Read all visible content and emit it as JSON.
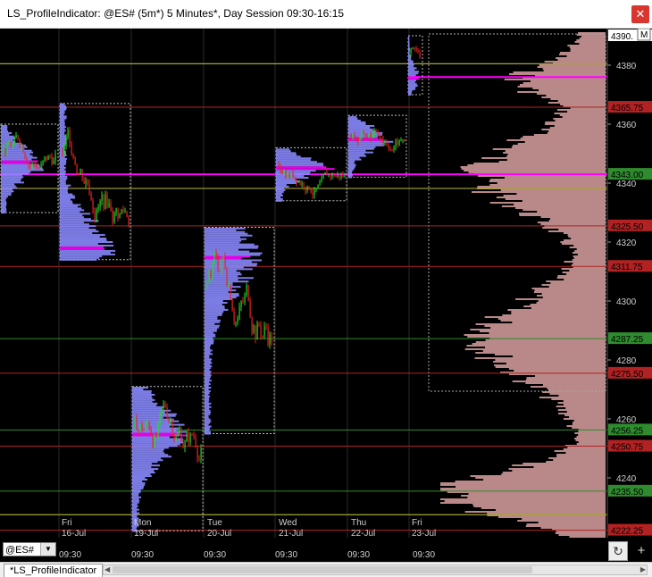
{
  "window": {
    "title": "LS_ProfileIndicator: @ES# (5m*) 5 Minutes*, Day Session 09:30-16:15",
    "close_glyph": "✕"
  },
  "chart": {
    "price_labels": [
      {
        "text": "4390.",
        "price": 4390.0,
        "bg": "#ffffff",
        "fg": "#000000"
      },
      {
        "text": "4365.75",
        "price": 4365.75,
        "bg": "#b22222",
        "fg": "#000000"
      },
      {
        "text": "4343.00",
        "price": 4343.0,
        "bg": "#2e8b2e",
        "fg": "#000000"
      },
      {
        "text": "4325.50",
        "price": 4325.5,
        "bg": "#b22222",
        "fg": "#000000"
      },
      {
        "text": "4311.75",
        "price": 4311.75,
        "bg": "#b22222",
        "fg": "#000000"
      },
      {
        "text": "4287.25",
        "price": 4287.25,
        "bg": "#2e8b2e",
        "fg": "#000000"
      },
      {
        "text": "4275.50",
        "price": 4275.5,
        "bg": "#b22222",
        "fg": "#000000"
      },
      {
        "text": "4256.25",
        "price": 4256.25,
        "bg": "#2e8b2e",
        "fg": "#000000"
      },
      {
        "text": "4250.75",
        "price": 4250.75,
        "bg": "#b22222",
        "fg": "#000000"
      },
      {
        "text": "4235.50",
        "price": 4235.5,
        "bg": "#2e8b2e",
        "fg": "#000000"
      },
      {
        "text": "4222.25",
        "price": 4222.25,
        "bg": "#b22222",
        "fg": "#000000"
      }
    ],
    "axis_ticks": [
      "4380",
      "4360",
      "4340",
      "4320",
      "4300",
      "4280",
      "4260",
      "4240"
    ],
    "axis_tick_values": [
      4380,
      4360,
      4340,
      4320,
      4300,
      4280,
      4260,
      4240
    ],
    "marker_letter": "M",
    "days": [
      {
        "weekday": "Fri",
        "date": "16-Jul"
      },
      {
        "weekday": "Mon",
        "date": "19-Jul"
      },
      {
        "weekday": "Tue",
        "date": "20-Jul"
      },
      {
        "weekday": "Wed",
        "date": "21-Jul"
      },
      {
        "weekday": "Thu",
        "date": "22-Jul"
      },
      {
        "weekday": "Fri",
        "date": "23-Jul"
      }
    ],
    "colors": {
      "background": "#000000",
      "profile": "#8a8aff",
      "composite_profile": "#d9a0a0",
      "poc": "#ff00ff",
      "value_area_line": "#a6a630",
      "support_line": "#2e8b2e",
      "resistance_line": "#b22222",
      "up_candle": "#22dd22",
      "down_candle": "#ee2222"
    }
  },
  "footer": {
    "symbol": "@ES#",
    "times": [
      "09:30",
      "09:30",
      "09:30",
      "09:30",
      "09:30",
      "09:30"
    ],
    "refresh_glyph": "↻",
    "add_glyph": "+"
  },
  "tabs": [
    {
      "label": "*LS_ProfileIndicator"
    }
  ]
}
